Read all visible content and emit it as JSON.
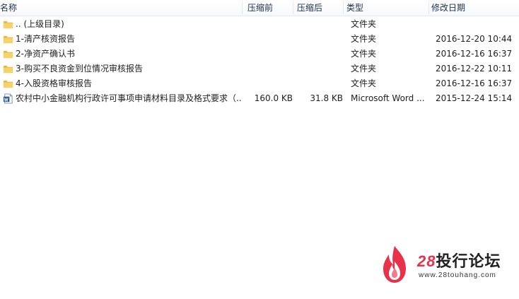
{
  "columns": {
    "name": "名称",
    "size_before": "压缩前",
    "size_after": "压缩后",
    "type": "类型",
    "modified": "修改日期"
  },
  "rows": [
    {
      "icon": "folder-icon",
      "name": ".. (上级目录)",
      "size_before": "",
      "size_after": "",
      "type": "文件夹",
      "modified": ""
    },
    {
      "icon": "folder-icon",
      "name": "1-清产核资报告",
      "size_before": "",
      "size_after": "",
      "type": "文件夹",
      "modified": "2016-12-20 10:44"
    },
    {
      "icon": "folder-icon",
      "name": "2-净资产确认书",
      "size_before": "",
      "size_after": "",
      "type": "文件夹",
      "modified": "2016-12-16 16:37"
    },
    {
      "icon": "folder-icon",
      "name": "3-购买不良资金到位情况审核报告",
      "size_before": "",
      "size_after": "",
      "type": "文件夹",
      "modified": "2016-12-22 10:11"
    },
    {
      "icon": "folder-icon",
      "name": "4-入股资格审核报告",
      "size_before": "",
      "size_after": "",
      "type": "文件夹",
      "modified": "2016-12-16 16:37"
    },
    {
      "icon": "word-doc-icon",
      "name": "农村中小金融机构行政许可事项申请材料目录及格式要求（...",
      "size_before": "160.0 KB",
      "size_after": "31.8 KB",
      "type": "Microsoft Word ...",
      "modified": "2015-12-24 15:14"
    }
  ],
  "watermark": {
    "number": "28",
    "title": "投行论坛",
    "url": "www.28touhang.com",
    "colors": {
      "accent": "#e8314a",
      "text": "#222222"
    }
  },
  "colors": {
    "folder": "#f2c94c",
    "header_text": "#1e3050",
    "word_blue": "#2b579a"
  }
}
